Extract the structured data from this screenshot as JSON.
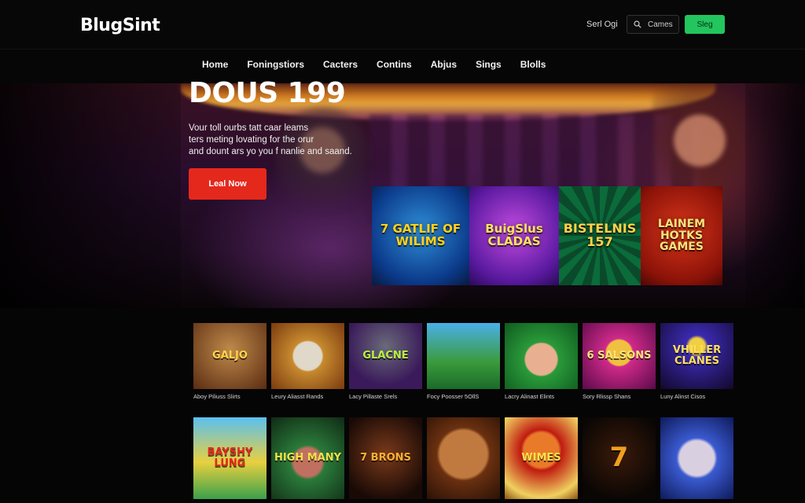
{
  "header": {
    "logo": "BlugSint",
    "signin_label": "Serl Ogi",
    "search_placeholder": "Cames",
    "signup_label": "Sleg"
  },
  "nav": {
    "items": [
      "Home",
      "Foningstiors",
      "Cacters",
      "Contins",
      "Abjus",
      "Sings",
      "Blolls"
    ]
  },
  "hero": {
    "title": "DOUS 199",
    "desc_line1": "Vour toll ourbs tatt caar leams",
    "desc_line2": "ters meting lovating for the orur",
    "desc_line3": "and dount ars yo you f nanlie and saand.",
    "cta_label": "Leal Now"
  },
  "featured": [
    {
      "title": "7 GATLIF OF WILIMS"
    },
    {
      "title": "BuigSlus CLADAS"
    },
    {
      "title": "BISTELNIS 157"
    },
    {
      "title": "LAINEM HOTKS GAMES"
    }
  ],
  "games_row1": [
    {
      "title": "GALJO",
      "caption": "Aboy Piliuss Slirts"
    },
    {
      "title": "",
      "caption": "Leury Aliasst Rands"
    },
    {
      "title": "GLACNE",
      "caption": "Lacy Pillaste Srels"
    },
    {
      "title": "",
      "caption": "Focy Poosser 5OllS"
    },
    {
      "title": "",
      "caption": "Lacry Alinast Elints"
    },
    {
      "title": "6 SALSONS",
      "caption": "Sory Rlissp Shans"
    },
    {
      "title": "VHILLER CLANES",
      "caption": "Luny Alinst Cisos"
    }
  ],
  "games_row2": [
    {
      "title": "BAYSHY LUNG"
    },
    {
      "title": "HIGH MANY"
    },
    {
      "title": "7 BRONS"
    },
    {
      "title": ""
    },
    {
      "title": "WIMES"
    },
    {
      "title": "7"
    },
    {
      "title": ""
    }
  ],
  "colors": {
    "accent_red": "#e5281c",
    "accent_green": "#22c55e",
    "background": "#050505"
  }
}
